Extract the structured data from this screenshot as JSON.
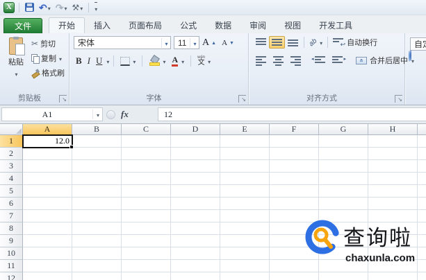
{
  "icons": {
    "excel_logo": "X",
    "undo": "↶",
    "redo": "↷",
    "tools": "⚒",
    "scissors": "✂",
    "orientation": "ab",
    "phonetic_ruby": "wén",
    "phonetic_char": "文",
    "increase_font": "A",
    "decrease_font": "A"
  },
  "tabs": {
    "items": [
      {
        "label": "文件"
      },
      {
        "label": "开始"
      },
      {
        "label": "插入"
      },
      {
        "label": "页面布局"
      },
      {
        "label": "公式"
      },
      {
        "label": "数据"
      },
      {
        "label": "审阅"
      },
      {
        "label": "视图"
      },
      {
        "label": "开发工具"
      }
    ],
    "active": "开始"
  },
  "ribbon": {
    "clipboard": {
      "group_label": "剪贴板",
      "paste": "粘贴",
      "cut": "剪切",
      "copy": "复制",
      "format_painter": "格式刷"
    },
    "font": {
      "group_label": "字体",
      "font_name": "宋体",
      "font_size": "11",
      "bold": "B",
      "italic": "I",
      "underline": "U"
    },
    "alignment": {
      "group_label": "对齐方式",
      "wrap_text": "自动换行",
      "merge_center": "合并后居中"
    },
    "number": {
      "value": "自定义"
    }
  },
  "formula_bar": {
    "name_box": "A1",
    "fx": "fx",
    "value": "12"
  },
  "grid": {
    "col_headers": [
      "A",
      "B",
      "C",
      "D",
      "E",
      "F",
      "G",
      "H"
    ],
    "row_headers": [
      "1",
      "2",
      "3",
      "4",
      "5",
      "6",
      "7",
      "8",
      "9",
      "10",
      "11",
      "12"
    ],
    "selected_cell": "A1",
    "a1_value": "12.0"
  },
  "watermark": {
    "title": "查询啦",
    "domain": "chaxunla.com",
    "ring_color": "#2f6fe4",
    "glass_color": "#f7a40f"
  },
  "colors": {
    "file_tab_green": "#1e7a32",
    "selected_header": "#f8c55c",
    "font_color_red": "#d43c2a",
    "fill_color_yellow": "#ffe14d"
  }
}
